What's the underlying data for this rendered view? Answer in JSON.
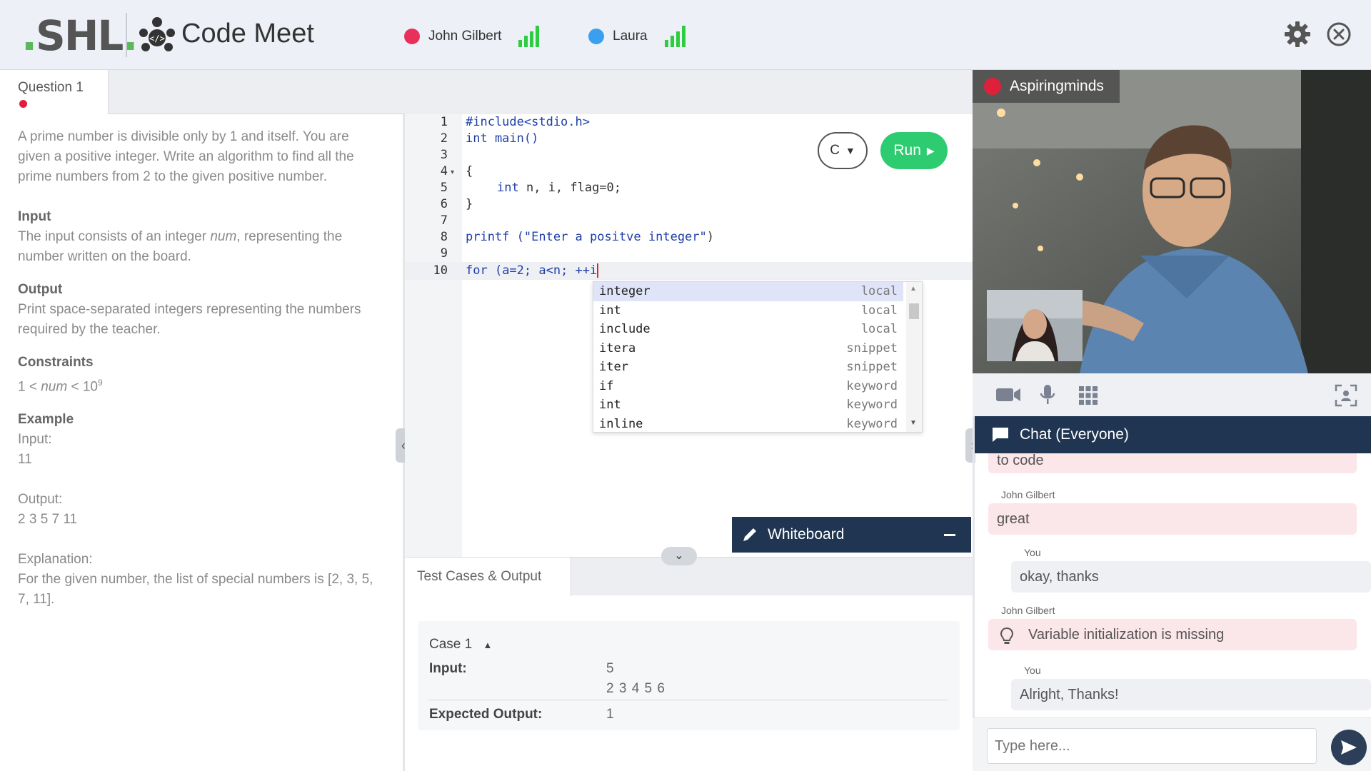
{
  "header": {
    "logo_text": "SHL",
    "logo_dot": ".",
    "app_title": "Code Meet",
    "participants": [
      {
        "name": "John Gilbert",
        "color": "#e8305a"
      },
      {
        "name": "Laura",
        "color": "#3aa0ee"
      }
    ]
  },
  "question": {
    "tab_label": "Question 1",
    "description": "A prime number is divisible only by 1 and itself. You are given a positive integer. Write an algorithm to find all the prime numbers from 2 to the given positive number.",
    "input_title": "Input",
    "input_pre": "The input consists of an integer ",
    "input_var": "num",
    "input_post": ", representing the number written on the board.",
    "output_title": "Output",
    "output_text": "Print space-separated integers representing the numbers required by the teacher.",
    "constraints_title": "Constraints",
    "constraints_left": "1 < ",
    "constraints_var": "num",
    "constraints_mid": " < 10",
    "constraints_exp": "9",
    "example_title": "Example",
    "example_input_label": "Input:",
    "example_input_value": "11",
    "example_output_label": "Output:",
    "example_output_value": "2 3 5 7 11",
    "explanation_label": "Explanation:",
    "explanation_text": "For the given number, the list of special numbers is [2, 3, 5, 7, 11]."
  },
  "editor": {
    "line_numbers": [
      "1",
      "2",
      "3",
      "4",
      "5",
      "6",
      "7",
      "8",
      "9",
      "10"
    ],
    "lines": {
      "l1": "#include<stdio.h>",
      "l2": "int main()",
      "l4": "{",
      "l5_kw": "int",
      "l5_rest": " n, i, flag=0;",
      "l6": "}",
      "l8_fn": "printf (",
      "l8_str": "\"Enter a positve integer\"",
      "l8_end": ")",
      "l10_kw": "for",
      "l10_rest": " (a=2; a<n; ++i"
    },
    "language": "C",
    "run_label": "Run",
    "autocomplete": [
      {
        "name": "integer",
        "kind": "local"
      },
      {
        "name": "int",
        "kind": "local"
      },
      {
        "name": "include",
        "kind": "local"
      },
      {
        "name": "itera",
        "kind": "snippet"
      },
      {
        "name": "iter",
        "kind": "snippet"
      },
      {
        "name": "if",
        "kind": "keyword"
      },
      {
        "name": "int",
        "kind": "keyword"
      },
      {
        "name": "inline",
        "kind": "keyword"
      }
    ],
    "whiteboard_label": "Whiteboard"
  },
  "tests": {
    "tab_label": "Test Cases & Output",
    "case_label": "Case 1",
    "input_label": "Input:",
    "input_value_1": "5",
    "input_value_2": "2 3 4 5 6",
    "expected_label": "Expected Output:",
    "expected_value": "1"
  },
  "video": {
    "label": "Aspiringminds"
  },
  "chat": {
    "title": "Chat (Everyone)",
    "messages": [
      {
        "sender": "",
        "text": "to code",
        "from": "them"
      },
      {
        "sender": "John Gilbert",
        "text": "great",
        "from": "them"
      },
      {
        "sender": "You",
        "text": "okay, thanks",
        "from": "me"
      },
      {
        "sender": "John Gilbert",
        "text": "Variable initialization is missing",
        "from": "them"
      },
      {
        "sender": "You",
        "text": "Alright, Thanks!",
        "from": "me"
      }
    ],
    "input_placeholder": "Type here..."
  }
}
